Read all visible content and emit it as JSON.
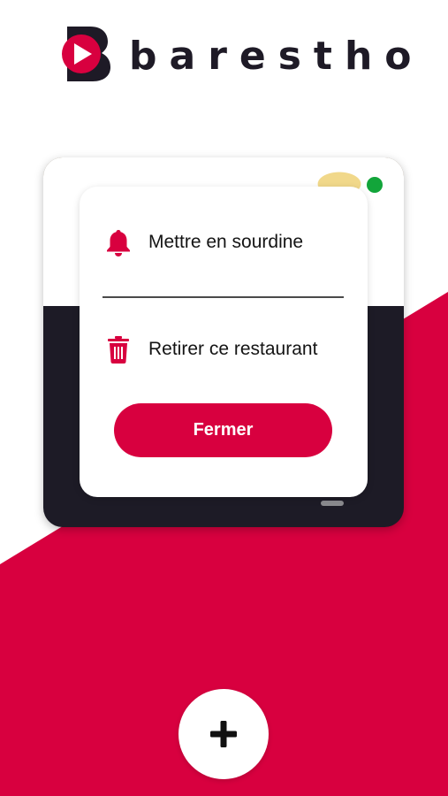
{
  "app": {
    "brand_name": "barestho",
    "logo_icon": "barestho-logo-icon"
  },
  "card": {
    "status_icon": "online-status-dot",
    "status_color": "#12a53a"
  },
  "menu": {
    "items": [
      {
        "label": "Mettre en sourdine",
        "icon": "bell-icon"
      },
      {
        "label": "Retirer ce restaurant",
        "icon": "trash-icon"
      }
    ],
    "close_label": "Fermer"
  },
  "fab": {
    "icon": "plus-icon"
  },
  "colors": {
    "accent": "#d8003f",
    "dark": "#1d1b26",
    "background": "#ffffff"
  }
}
